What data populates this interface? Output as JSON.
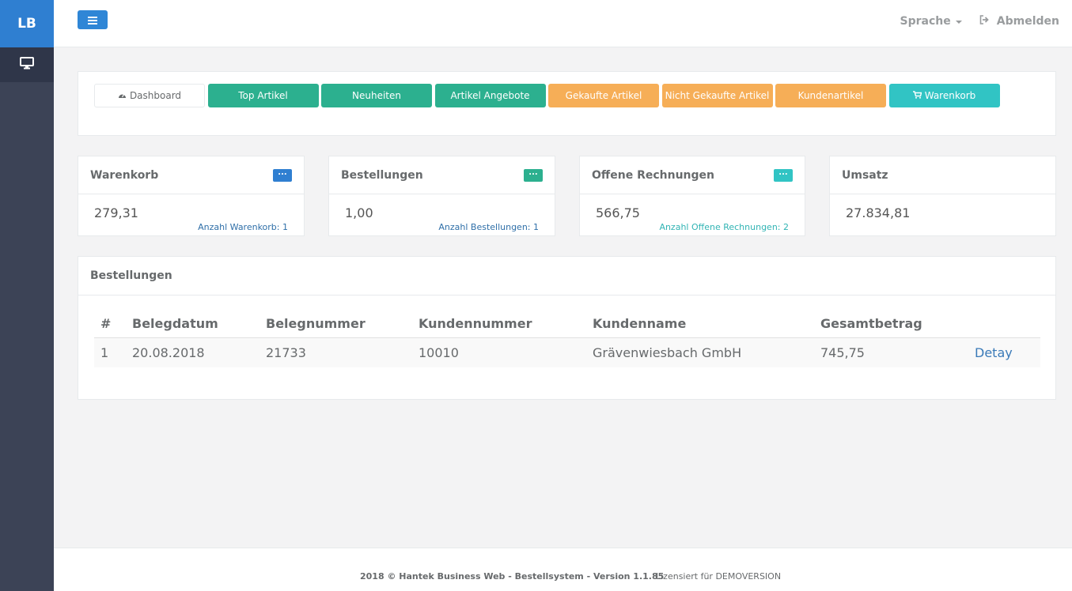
{
  "sidebar": {
    "logo": "LB",
    "items": [
      {
        "icon": "desktop-icon"
      }
    ]
  },
  "topbar": {
    "menu_icon": "hamburger-icon",
    "language_label": "Sprache",
    "logout_label": "Abmelden",
    "logout_icon": "sign-out-icon"
  },
  "nav": {
    "buttons": [
      {
        "label": "Dashboard",
        "icon": "tachometer-icon",
        "color": "#ffffff"
      },
      {
        "label": "Top Artikel",
        "color": "#2cb08f"
      },
      {
        "label": "Neuheiten",
        "color": "#2cb08f"
      },
      {
        "label": "Artikel Angebote",
        "color": "#2cb08f"
      },
      {
        "label": "Gekaufte Artikel",
        "color": "#f6ae57"
      },
      {
        "label": "Nicht Gekaufte Artikel",
        "color": "#f6ae57"
      },
      {
        "label": "Kundenartikel",
        "color": "#f6ae57"
      },
      {
        "label": "Warenkorb",
        "icon": "shopping-cart-icon",
        "color": "#31c4c4"
      }
    ]
  },
  "stats": {
    "cart": {
      "title": "Warenkorb",
      "badge": "...",
      "badge_color": "#2f7fd1",
      "value": "279,31",
      "sub": "Anzahl Warenkorb: 1",
      "sub_color": "#2f6fa8"
    },
    "orders": {
      "title": "Bestellungen",
      "badge": "...",
      "badge_color": "#2cb08f",
      "value": "1,00",
      "sub": "Anzahl Bestellungen: 1",
      "sub_color": "#2f6fa8"
    },
    "invoices": {
      "title": "Offene Rechnungen",
      "badge": "...",
      "badge_color": "#31c4c4",
      "value": "566,75",
      "sub": "Anzahl Offene Rechnungen: 2",
      "sub_color": "#31b4b4"
    },
    "revenue": {
      "title": "Umsatz",
      "value": "27.834,81"
    }
  },
  "orders_table": {
    "title": "Bestellungen",
    "columns": [
      "#",
      "Belegdatum",
      "Belegnummer",
      "Kundennummer",
      "Kundenname",
      "Gesamtbetrag",
      ""
    ],
    "rows": [
      {
        "num": "1",
        "date": "20.08.2018",
        "doc_number": "21733",
        "customer_number": "10010",
        "customer_name": "Grävenwiesbach GmbH",
        "total": "745,75",
        "action": "Detay"
      }
    ]
  },
  "footer": {
    "copyright": "2018 © Hantek Business Web - Bestellsystem - Version 1.1.85",
    "license": "Lizensiert für DEMOVERSION"
  }
}
